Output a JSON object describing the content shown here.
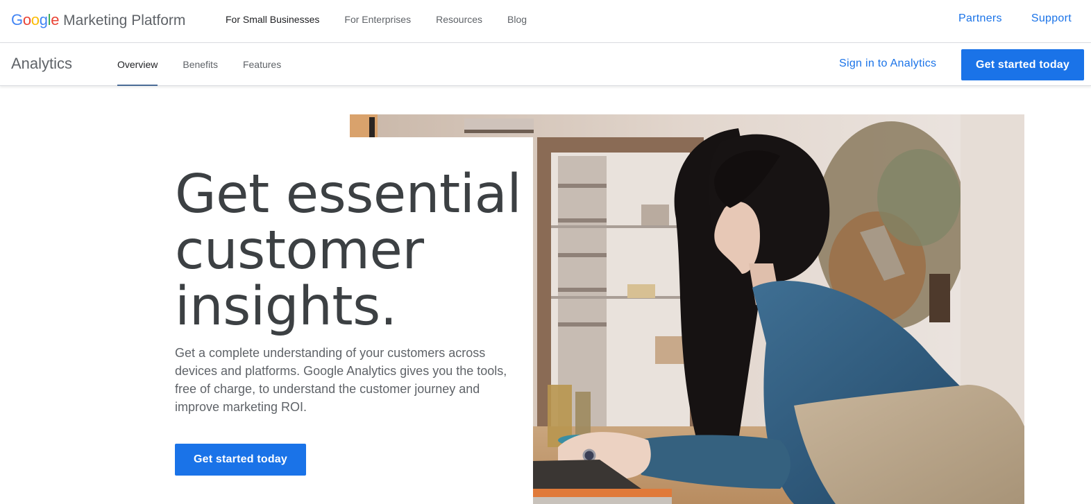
{
  "topbar": {
    "brand": {
      "logo_letters": [
        {
          "char": "G",
          "color": "#4285f4"
        },
        {
          "char": "o",
          "color": "#ea4335"
        },
        {
          "char": "o",
          "color": "#fbbc05"
        },
        {
          "char": "g",
          "color": "#4285f4"
        },
        {
          "char": "l",
          "color": "#34a853"
        },
        {
          "char": "e",
          "color": "#ea4335"
        }
      ],
      "product": "Marketing Platform"
    },
    "nav": [
      {
        "label": "For Small Businesses"
      },
      {
        "label": "For Enterprises"
      },
      {
        "label": "Resources"
      },
      {
        "label": "Blog"
      }
    ],
    "right_links": [
      {
        "label": "Partners"
      },
      {
        "label": "Support"
      }
    ]
  },
  "subbar": {
    "section_title": "Analytics",
    "tabs": [
      {
        "label": "Overview",
        "active": true
      },
      {
        "label": "Benefits",
        "active": false
      },
      {
        "label": "Features",
        "active": false
      }
    ],
    "signin_label": "Sign in to Analytics",
    "cta_label": "Get started today"
  },
  "hero": {
    "title_lines": [
      "Get essential",
      "customer",
      "insights."
    ],
    "description": "Get a complete understanding of your customers across devices and platforms. Google Analytics gives you the tools, free of charge, to understand the customer journey and improve marketing ROI.",
    "cta_label": "Get started today",
    "image_alt": "Woman in denim shirt and apron typing on a laptop in a shop"
  },
  "colors": {
    "accent": "#1a73e8",
    "text_primary": "#3c4043",
    "text_secondary": "#5f6368",
    "tab_indicator": "#4a6b96",
    "divider": "#dadce0"
  }
}
